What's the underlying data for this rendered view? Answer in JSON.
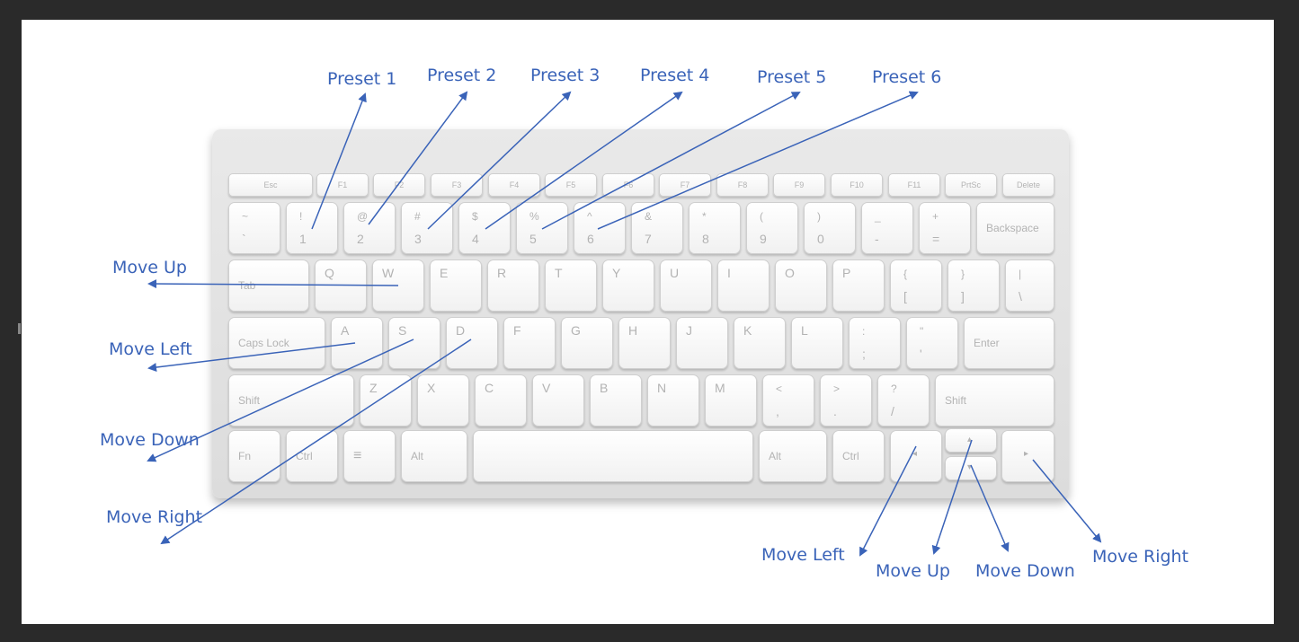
{
  "keyboard": {
    "row0": [
      "Esc",
      "F1",
      "F2",
      "F3",
      "F4",
      "F5",
      "F6",
      "F7",
      "F8",
      "F9",
      "F10",
      "F11",
      "PrtSc",
      "Delete"
    ],
    "row1": [
      {
        "top": "~",
        "bottom": "`"
      },
      {
        "top": "!",
        "bottom": "1"
      },
      {
        "top": "@",
        "bottom": "2"
      },
      {
        "top": "#",
        "bottom": "3"
      },
      {
        "top": "$",
        "bottom": "4"
      },
      {
        "top": "%",
        "bottom": "5"
      },
      {
        "top": "^",
        "bottom": "6"
      },
      {
        "top": "&",
        "bottom": "7"
      },
      {
        "top": "*",
        "bottom": "8"
      },
      {
        "top": "(",
        "bottom": "9"
      },
      {
        "top": ")",
        "bottom": "0"
      },
      {
        "top": "_",
        "bottom": "-"
      },
      {
        "top": "+",
        "bottom": "="
      },
      {
        "top": "Backspace",
        "bottom": ""
      }
    ],
    "row2": [
      "Tab",
      "Q",
      "W",
      "E",
      "R",
      "T",
      "Y",
      "U",
      "I",
      "O",
      "P",
      {
        "top": "{",
        "bottom": "["
      },
      {
        "top": "}",
        "bottom": "]"
      },
      {
        "top": "|",
        "bottom": "\\"
      }
    ],
    "row3": [
      "Caps Lock",
      "A",
      "S",
      "D",
      "F",
      "G",
      "H",
      "J",
      "K",
      "L",
      {
        "top": ":",
        "bottom": ";"
      },
      {
        "top": "\"",
        "bottom": "'"
      },
      "Enter"
    ],
    "row4": [
      "Shift",
      "Z",
      "X",
      "C",
      "V",
      "B",
      "N",
      "M",
      {
        "top": "<",
        "bottom": ","
      },
      {
        "top": ">",
        "bottom": "."
      },
      {
        "top": "?",
        "bottom": "/"
      },
      "Shift"
    ],
    "row5": [
      "Fn",
      "Ctrl",
      "≡",
      "Alt",
      "",
      "Alt",
      "Ctrl"
    ],
    "arrows": {
      "left": "◂",
      "up": "▴",
      "down": "▾",
      "right": "▸"
    }
  },
  "labels": {
    "preset1": "Preset 1",
    "preset2": "Preset 2",
    "preset3": "Preset 3",
    "preset4": "Preset 4",
    "preset5": "Preset 5",
    "preset6": "Preset 6",
    "move_up_w": "Move Up",
    "move_left_a": "Move Left",
    "move_down_s": "Move Down",
    "move_right_d": "Move Right",
    "move_left_arrow": "Move Left",
    "move_up_arrow": "Move Up",
    "move_down_arrow": "Move Down",
    "move_right_arrow": "Move Right"
  },
  "colors": {
    "annotation": "#3a63b8",
    "background": "#2a2a2a",
    "canvas": "#ffffff"
  }
}
